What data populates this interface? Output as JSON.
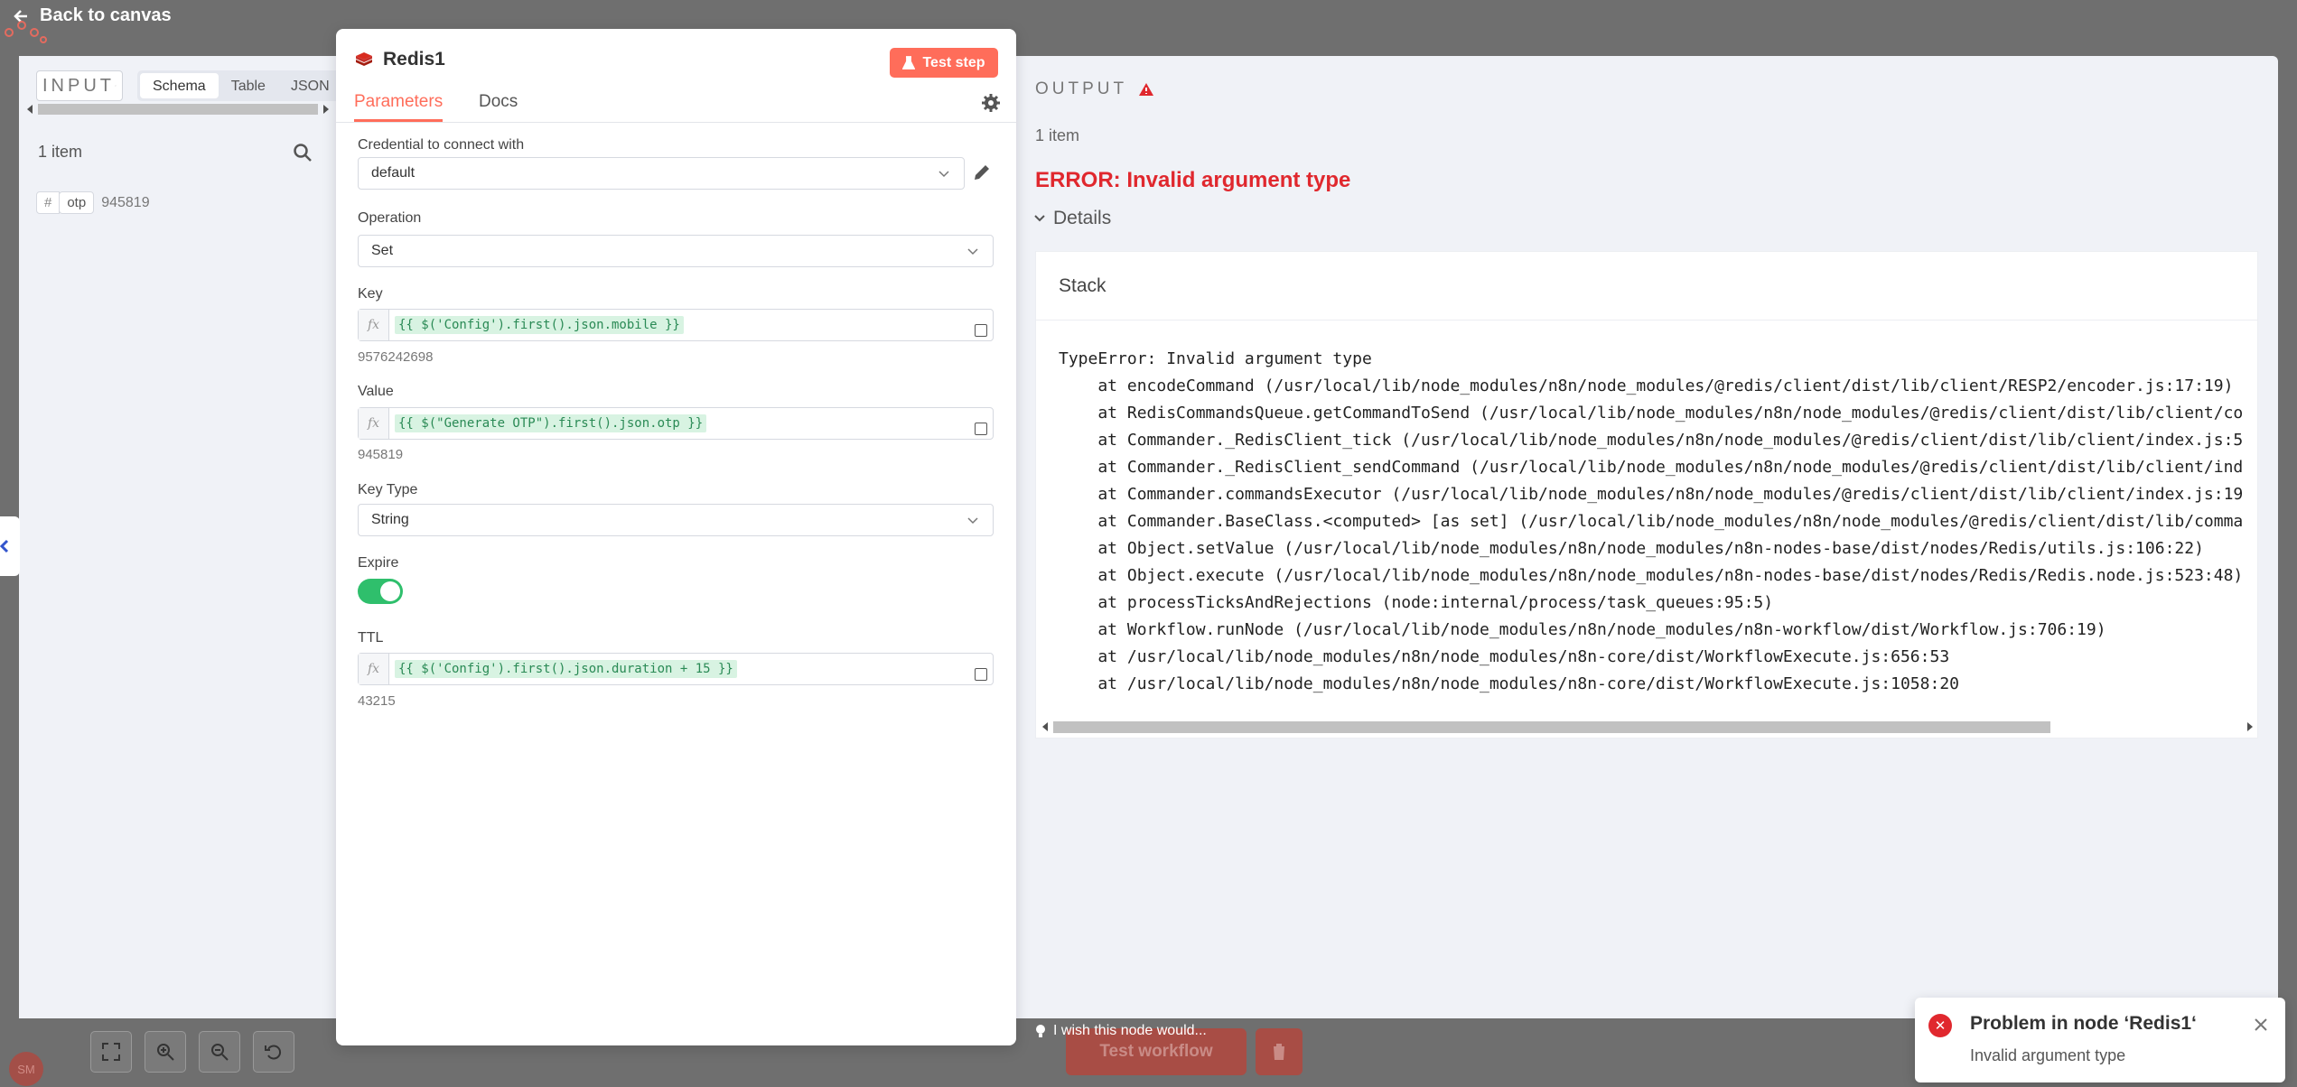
{
  "nav": {
    "back_label": "Back to canvas"
  },
  "input": {
    "selector_label": "INPUT",
    "tabs": [
      "Schema",
      "Table",
      "JSON"
    ],
    "item_count": "1 item",
    "schema": {
      "type_icon": "#",
      "field": "otp",
      "value": "945819"
    }
  },
  "node": {
    "title": "Redis1",
    "test_step_label": "Test step",
    "tabs": {
      "parameters": "Parameters",
      "docs": "Docs"
    }
  },
  "params": {
    "credential": {
      "label": "Credential to connect with",
      "value": "default"
    },
    "operation": {
      "label": "Operation",
      "value": "Set"
    },
    "key": {
      "label": "Key",
      "expression": "{{ $('Config').first().json.mobile }}",
      "result": "9576242698"
    },
    "value": {
      "label": "Value",
      "expression": "{{ $(\"Generate OTP\").first().json.otp }}",
      "result": "945819"
    },
    "key_type": {
      "label": "Key Type",
      "value": "String"
    },
    "expire": {
      "label": "Expire",
      "enabled": true
    },
    "ttl": {
      "label": "TTL",
      "expression": "{{ $('Config').first().json.duration + 15 }}",
      "result": "43215"
    },
    "fx_label": "fx"
  },
  "output": {
    "label": "OUTPUT",
    "item_count": "1 item",
    "error_title": "ERROR: Invalid argument type",
    "details_label": "Details",
    "stack_label": "Stack",
    "stack_lines": [
      "TypeError: Invalid argument type",
      "    at encodeCommand (/usr/local/lib/node_modules/n8n/node_modules/@redis/client/dist/lib/client/RESP2/encoder.js:17:19)",
      "    at RedisCommandsQueue.getCommandToSend (/usr/local/lib/node_modules/n8n/node_modules/@redis/client/dist/lib/client/co",
      "    at Commander._RedisClient_tick (/usr/local/lib/node_modules/n8n/node_modules/@redis/client/dist/lib/client/index.js:5",
      "    at Commander._RedisClient_sendCommand (/usr/local/lib/node_modules/n8n/node_modules/@redis/client/dist/lib/client/ind",
      "    at Commander.commandsExecutor (/usr/local/lib/node_modules/n8n/node_modules/@redis/client/dist/lib/client/index.js:19",
      "    at Commander.BaseClass.<computed> [as set] (/usr/local/lib/node_modules/n8n/node_modules/@redis/client/dist/lib/comma",
      "    at Object.setValue (/usr/local/lib/node_modules/n8n/node_modules/n8n-nodes-base/dist/nodes/Redis/utils.js:106:22)",
      "    at Object.execute (/usr/local/lib/node_modules/n8n/node_modules/n8n-nodes-base/dist/nodes/Redis/Redis.node.js:523:48)",
      "    at processTicksAndRejections (node:internal/process/task_queues:95:5)",
      "    at Workflow.runNode (/usr/local/lib/node_modules/n8n/node_modules/n8n-workflow/dist/Workflow.js:706:19)",
      "    at /usr/local/lib/node_modules/n8n/node_modules/n8n-core/dist/WorkflowExecute.js:656:53",
      "    at /usr/local/lib/node_modules/n8n/node_modules/n8n-core/dist/WorkflowExecute.js:1058:20"
    ]
  },
  "bottom": {
    "wish_label": "I wish this node would...",
    "test_workflow_label": "Test workflow",
    "avatar_initials": "SM"
  },
  "toast": {
    "title": "Problem in node ‘Redis1‘",
    "message": "Invalid argument type"
  },
  "colors": {
    "accent": "#ff6d5a",
    "error": "#e0282e",
    "toggle_on": "#2fbf6c"
  }
}
